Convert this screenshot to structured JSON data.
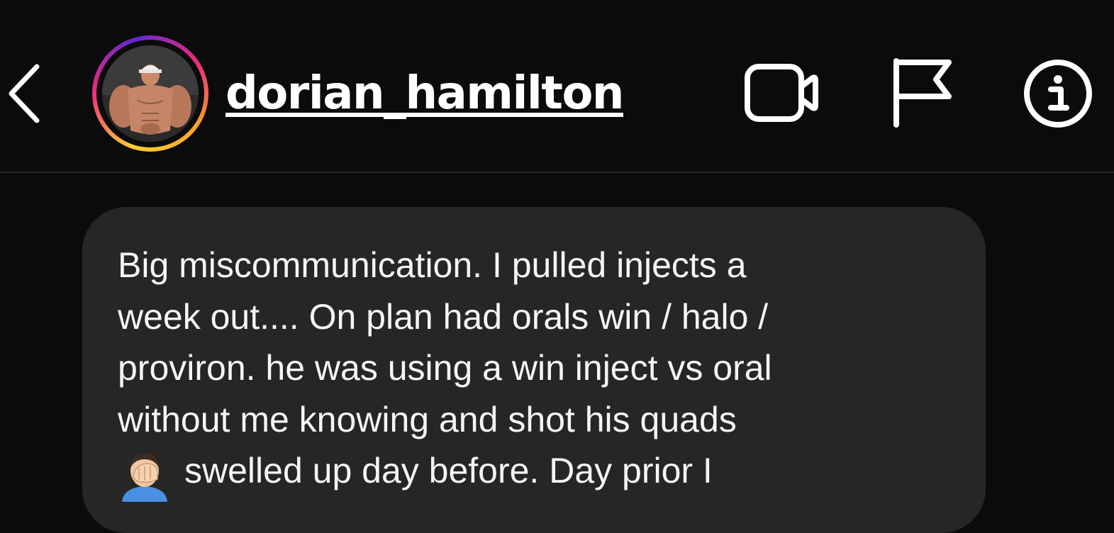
{
  "header": {
    "back_icon": "chevron-left-icon",
    "username": "dorian_hamilton",
    "actions": [
      {
        "name": "video-call",
        "icon": "video-camera-icon"
      },
      {
        "name": "report",
        "icon": "flag-icon"
      },
      {
        "name": "details",
        "icon": "info-icon"
      }
    ],
    "avatar_ring_colors": [
      "#f9ce34",
      "#ee2a7b",
      "#6228d7"
    ]
  },
  "message": {
    "lines": [
      "Big miscommunication. I pulled injects a",
      "week out.... On plan had orals win / halo /",
      "proviron. he was using a win inject vs oral",
      "without me knowing and shot his quads",
      "swelled up day before. Day prior I"
    ],
    "emoji": "face-palm-emoji",
    "bubble_color": "#262626"
  },
  "colors": {
    "background": "#0b0b0b",
    "text": "#ffffff"
  }
}
